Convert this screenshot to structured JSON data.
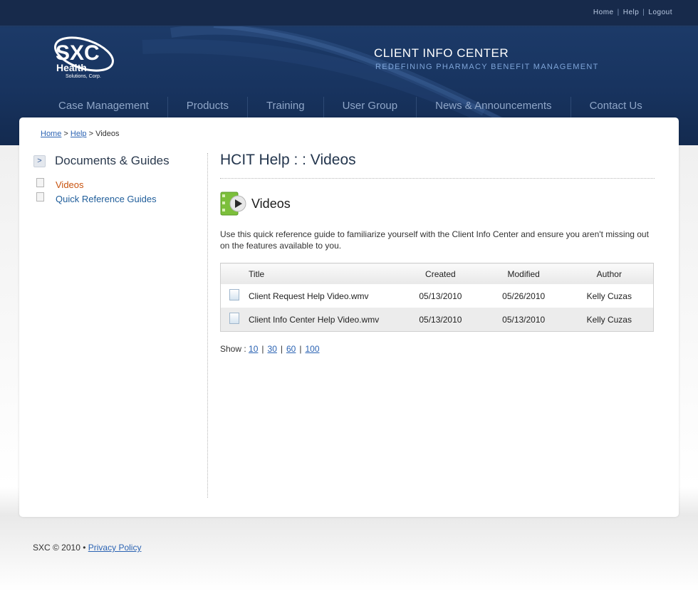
{
  "topbar": {
    "links": [
      "Home",
      "Help",
      "Logout"
    ]
  },
  "brand": {
    "logo_text": "SXC",
    "logo_line2": "Health",
    "logo_line3": "Solutions, Corp.",
    "title": "CLIENT INFO CENTER",
    "subtitle": "REDEFINING PHARMACY BENEFIT MANAGEMENT"
  },
  "nav": {
    "items": [
      "Case Management",
      "Products",
      "Training",
      "User Group",
      "News & Announcements",
      "Contact Us"
    ]
  },
  "breadcrumb": {
    "home": "Home",
    "help": "Help",
    "current": "Videos",
    "sep": ">"
  },
  "sidebar": {
    "title": "Documents & Guides",
    "arrow": ">",
    "items": [
      {
        "label": "Videos"
      },
      {
        "label": "Quick Reference Guides"
      }
    ]
  },
  "main": {
    "page_title": "HCIT Help : : Videos",
    "section_title": "Videos",
    "description": "Use this quick reference guide to familiarize yourself with the Client Info Center and ensure you aren't missing out on the features available to you.",
    "table": {
      "columns": [
        "Title",
        "Created",
        "Modified",
        "Author"
      ],
      "rows": [
        {
          "title": "Client Request Help Video.wmv",
          "created": "05/13/2010",
          "modified": "05/26/2010",
          "author": "Kelly Cuzas"
        },
        {
          "title": "Client Info Center Help Video.wmv",
          "created": "05/13/2010",
          "modified": "05/13/2010",
          "author": "Kelly Cuzas"
        }
      ]
    },
    "show": {
      "label": "Show :",
      "options": [
        "10",
        "30",
        "60",
        "100"
      ]
    }
  },
  "footer": {
    "copyright": "SXC © 2010 •",
    "privacy": "Privacy Policy"
  },
  "colors": {
    "header_dark": "#172a4b",
    "header_blue": "#1c3a68",
    "accent_orange": "#c8520d",
    "link_blue": "#2b63b3"
  }
}
